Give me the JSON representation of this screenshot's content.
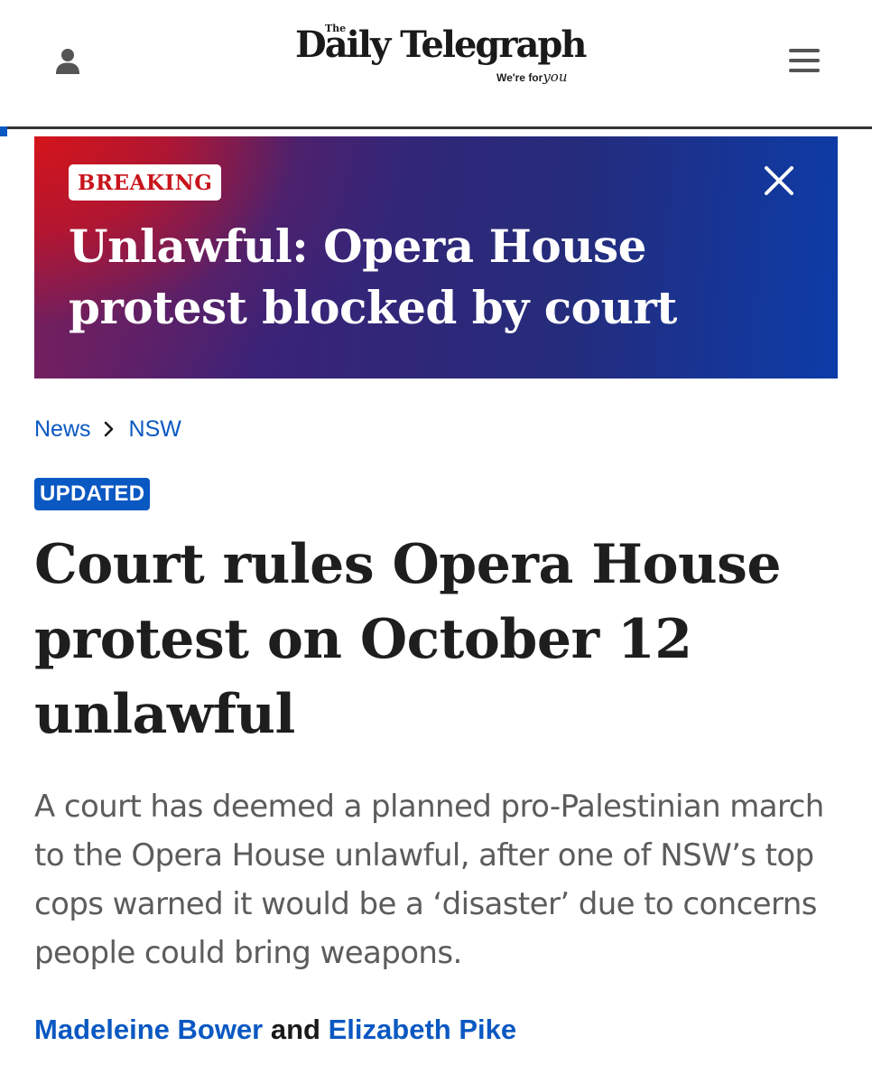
{
  "header": {
    "logo": {
      "the": "The",
      "name": "Daily Telegraph",
      "tagline": "We're for",
      "tagline_script": "you"
    },
    "icons": {
      "account": "user-icon",
      "menu": "hamburger-menu-icon"
    },
    "reading_progress": 0.01
  },
  "breaking": {
    "badge": "BREAKING",
    "headline": "Unlawful: Opera House protest blocked by court",
    "close_icon": "close-icon",
    "colors": {
      "left": "#d4151b",
      "middle": "#2a2a7a",
      "right": "#0c3ca8"
    }
  },
  "breadcrumb": {
    "items": [
      "News",
      "NSW"
    ],
    "separator_icon": "chevron-right-icon"
  },
  "article": {
    "badge": "UPDATED",
    "headline": "Court rules Opera House protest on October 12 unlawful",
    "standfirst": "A court has deemed a planned pro-Palestinian march to the Opera House unlawful, after one of NSW’s top cops warned it would be a ‘disaster’ due to concerns people could bring weapons.",
    "byline": {
      "authors": [
        "Madeleine Bower",
        "Elizabeth Pike"
      ],
      "joiner": "and"
    }
  },
  "colors": {
    "accent": "#0a58c2",
    "breaking_red": "#c8141c",
    "text": "#1e1e1e",
    "muted_text": "#5c5c5c"
  }
}
